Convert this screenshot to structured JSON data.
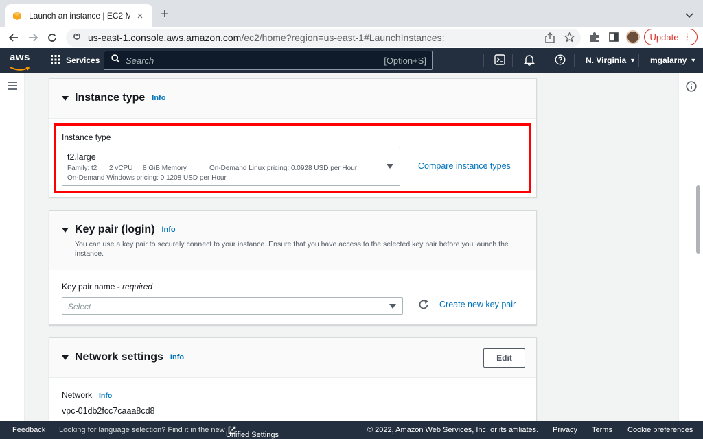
{
  "browser": {
    "tab_title": "Launch an instance | EC2 Mana",
    "url_host": "us-east-1.console.aws.amazon.com",
    "url_path": "/ec2/home?region=us-east-1#LaunchInstances:",
    "update_label": "Update"
  },
  "aws_nav": {
    "logo_text": "aws",
    "services_label": "Services",
    "search_placeholder": "Search",
    "search_shortcut": "[Option+S]",
    "region": "N. Virginia",
    "user": "mgalarny"
  },
  "instance_type_section": {
    "title": "Instance type",
    "info": "Info",
    "field_label": "Instance type",
    "selected": {
      "name": "t2.large",
      "family": "Family: t2",
      "vcpu": "2 vCPU",
      "memory": "8 GiB Memory",
      "linux_pricing": "On-Demand Linux pricing: 0.0928 USD per Hour",
      "windows_pricing": "On-Demand Windows pricing: 0.1208 USD per Hour"
    },
    "compare_link": "Compare instance types"
  },
  "key_pair_section": {
    "title": "Key pair (login)",
    "info": "Info",
    "description": "You can use a key pair to securely connect to your instance. Ensure that you have access to the selected key pair before you launch the instance.",
    "field_label": "Key pair name - ",
    "field_required": "required",
    "select_placeholder": "Select",
    "create_link": "Create new key pair"
  },
  "network_section": {
    "title": "Network settings",
    "info": "Info",
    "edit_label": "Edit",
    "network_label": "Network",
    "network_info": "Info",
    "network_value": "vpc-01db2fcc7caaa8cd8"
  },
  "footer": {
    "feedback": "Feedback",
    "language_text": "Looking for language selection? Find it in the new",
    "unified_settings": "Unified Settings",
    "copyright": "© 2022, Amazon Web Services, Inc. or its affiliates.",
    "privacy": "Privacy",
    "terms": "Terms",
    "cookie": "Cookie preferences"
  },
  "colors": {
    "aws_nav_bg": "#232f3e",
    "link": "#0073bb",
    "highlight": "#ff0000",
    "update": "#d93025"
  }
}
